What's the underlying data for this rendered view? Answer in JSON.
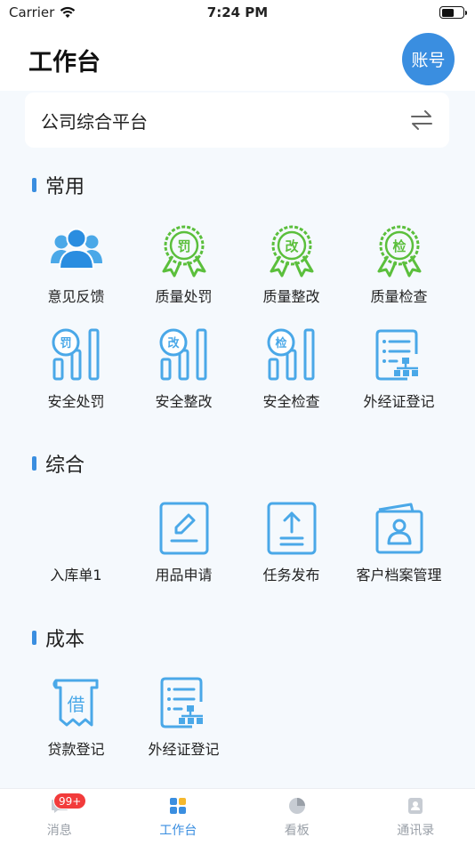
{
  "status_bar": {
    "carrier": "Carrier",
    "time": "7:24 PM"
  },
  "header": {
    "title": "工作台",
    "account_label": "账号"
  },
  "platform": {
    "name": "公司综合平台"
  },
  "sections": [
    {
      "title": "常用",
      "items": [
        {
          "label": "意见反馈",
          "icon": "users-icon"
        },
        {
          "label": "质量处罚",
          "icon": "award-penalty-icon",
          "glyph": "罚"
        },
        {
          "label": "质量整改",
          "icon": "award-rectify-icon",
          "glyph": "改"
        },
        {
          "label": "质量检查",
          "icon": "award-inspect-icon",
          "glyph": "检"
        },
        {
          "label": "安全处罚",
          "icon": "bar-penalty-icon",
          "glyph": "罚"
        },
        {
          "label": "安全整改",
          "icon": "bar-rectify-icon",
          "glyph": "改"
        },
        {
          "label": "安全检查",
          "icon": "bar-inspect-icon",
          "glyph": "检"
        },
        {
          "label": "外经证登记",
          "icon": "org-list-icon"
        }
      ]
    },
    {
      "title": "综合",
      "items": [
        {
          "label": "入库单1",
          "icon": "blank-icon"
        },
        {
          "label": "用品申请",
          "icon": "edit-form-icon"
        },
        {
          "label": "任务发布",
          "icon": "upload-form-icon"
        },
        {
          "label": "客户档案管理",
          "icon": "archive-user-icon"
        }
      ]
    },
    {
      "title": "成本",
      "items": [
        {
          "label": "贷款登记",
          "icon": "loan-scroll-icon",
          "glyph": "借"
        },
        {
          "label": "外经证登记",
          "icon": "org-list-icon"
        }
      ]
    }
  ],
  "tab_bar": {
    "items": [
      {
        "label": "消息",
        "icon": "message-icon",
        "badge": "99+"
      },
      {
        "label": "工作台",
        "icon": "grid-icon",
        "active": true
      },
      {
        "label": "看板",
        "icon": "pie-icon"
      },
      {
        "label": "通讯录",
        "icon": "contacts-icon"
      }
    ]
  },
  "colors": {
    "accent": "#3a8ee0",
    "green": "#5bbf3c",
    "icon_blue": "#4aa8e8",
    "badge": "#f23b3b"
  }
}
